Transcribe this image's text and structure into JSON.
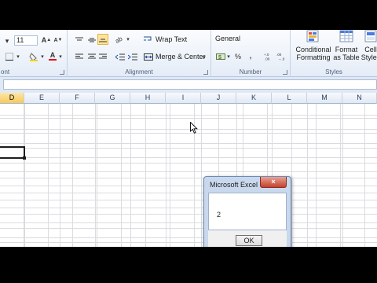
{
  "ribbon": {
    "font": {
      "size": "11",
      "label": "ont",
      "grow_glyph": "A",
      "shrink_glyph": "A",
      "font_color_glyph": "A"
    },
    "alignment": {
      "label": "Alignment",
      "wrap_text": "Wrap Text",
      "merge_center": "Merge & Center"
    },
    "number": {
      "label": "Number",
      "format": "General",
      "currency_glyph": "$",
      "percent_glyph": "%",
      "comma_glyph": ",",
      "increase_decimal": "+.0 .00",
      "decrease_decimal": ".00 →.0"
    },
    "styles": {
      "label": "Styles",
      "conditional_formatting": [
        "Conditional",
        "Formatting"
      ],
      "format_as_table": [
        "Format",
        "as Table"
      ],
      "cell_styles": [
        "Cell",
        "Styles"
      ]
    }
  },
  "columns": [
    "D",
    "E",
    "F",
    "G",
    "H",
    "I",
    "J",
    "K",
    "L",
    "M",
    "N"
  ],
  "active_column": "D",
  "dialog": {
    "title": "Microsoft Excel",
    "close_glyph": "×",
    "message": "2",
    "ok_label": "OK"
  },
  "colors": {
    "ribbon_bg": "#e4ecf7",
    "active_header": "#f8c95a",
    "close_red": "#c5412c"
  }
}
